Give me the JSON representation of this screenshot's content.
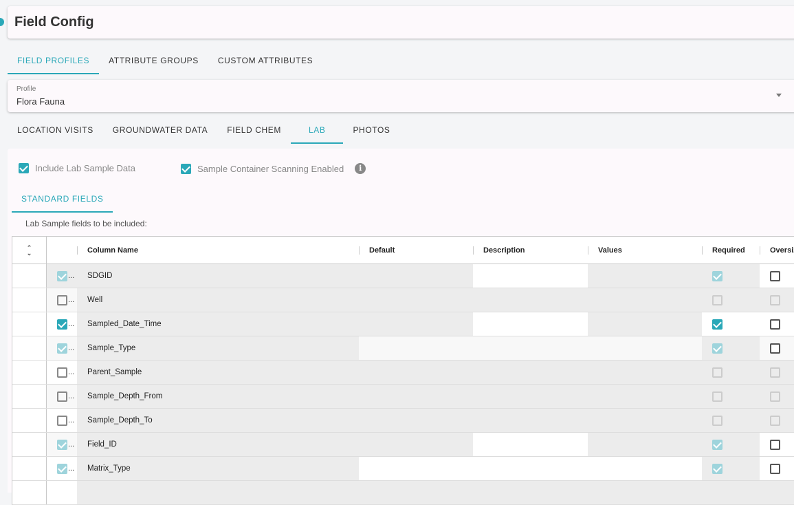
{
  "page": {
    "title": "Field Config"
  },
  "top_tabs": [
    "FIELD PROFILES",
    "ATTRIBUTE GROUPS",
    "CUSTOM ATTRIBUTES"
  ],
  "profile": {
    "label": "Profile",
    "value": "Flora Fauna"
  },
  "sub_tabs": [
    "LOCATION VISITS",
    "GROUNDWATER DATA",
    "FIELD CHEM",
    "LAB",
    "PHOTOS"
  ],
  "options": {
    "include_lab": {
      "label": "Include Lab Sample Data",
      "checked": true
    },
    "scanning": {
      "label": "Sample Container Scanning Enabled",
      "checked": true
    }
  },
  "standard_tab": "STANDARD FIELDS",
  "hint": "Lab Sample fields to be included:",
  "columns": [
    "Column Name",
    "Default",
    "Description",
    "Values",
    "Required",
    "Oversiz"
  ],
  "rows": [
    {
      "name": "SDGID",
      "included": "locked",
      "required": "locked",
      "oversize": "off"
    },
    {
      "name": "Well",
      "included": "off",
      "required": "disabled",
      "oversize": "disabled"
    },
    {
      "name": "Sampled_Date_Time",
      "included": "on",
      "required": "on",
      "oversize": "off"
    },
    {
      "name": "Sample_Type",
      "included": "locked",
      "required": "locked",
      "oversize": "off"
    },
    {
      "name": "Parent_Sample",
      "included": "off",
      "required": "disabled",
      "oversize": "disabled"
    },
    {
      "name": "Sample_Depth_From",
      "included": "off",
      "required": "disabled",
      "oversize": "disabled"
    },
    {
      "name": "Sample_Depth_To",
      "included": "off",
      "required": "disabled",
      "oversize": "disabled"
    },
    {
      "name": "Field_ID",
      "included": "locked",
      "required": "locked",
      "oversize": "off"
    },
    {
      "name": "Matrix_Type",
      "included": "locked",
      "required": "locked",
      "oversize": "off"
    }
  ],
  "colors": {
    "accent": "#2aa8b8"
  }
}
